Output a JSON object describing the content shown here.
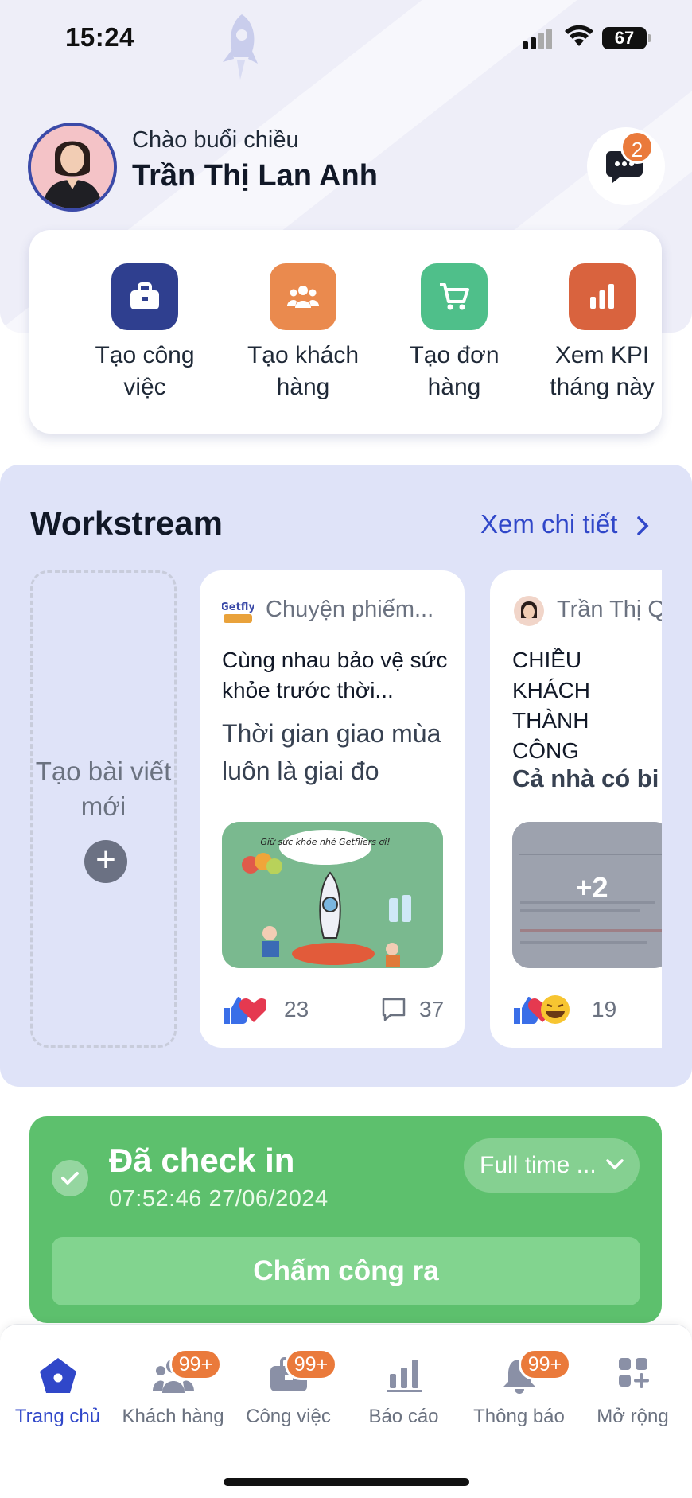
{
  "status_bar": {
    "time": "15:24",
    "battery": "67"
  },
  "greeting": {
    "subtitle": "Chào buổi chiều",
    "name": "Trần Thị Lan Anh",
    "chat_badge": "2"
  },
  "quick_actions": [
    {
      "label": "Tạo công việc",
      "icon": "briefcase-icon",
      "color": "#2f3f8f"
    },
    {
      "label": "Tạo khách hàng",
      "icon": "users-icon",
      "color": "#ea8a4e"
    },
    {
      "label": "Tạo đơn hàng",
      "icon": "cart-icon",
      "color": "#4fbf8a"
    },
    {
      "label": "Xem KPI tháng này",
      "icon": "bar-chart-icon",
      "color": "#d9633e"
    }
  ],
  "workstream": {
    "title": "Workstream",
    "link": "Xem chi tiết",
    "new_post_label": "Tạo bài viết mới",
    "posts": [
      {
        "author": "Chuyện phiếm...",
        "title": "Cùng nhau bảo vệ sức khỏe trước thời...",
        "body": "Thời gian giao mùa luôn là giai đo",
        "image_text": "Giữ sức khỏe nhé Getfliers ơi!",
        "likes": "23",
        "comments": "37"
      },
      {
        "author": "Trần Thị Q",
        "title": "CHIỀU KHÁCH THÀNH CÔNG",
        "body": "Cả nhà có bi",
        "image_more": "+2",
        "likes": "19"
      }
    ]
  },
  "checkin": {
    "title": "Đã check in",
    "time": "07:52:46 27/06/2024",
    "shift": "Full time ...",
    "button": "Chấm công ra"
  },
  "bottom_nav": [
    {
      "label": "Trang chủ",
      "icon": "home-icon",
      "active": true
    },
    {
      "label": "Khách hàng",
      "icon": "customers-icon",
      "badge": "99+"
    },
    {
      "label": "Công việc",
      "icon": "work-icon",
      "badge": "99+"
    },
    {
      "label": "Báo cáo",
      "icon": "report-icon"
    },
    {
      "label": "Thông báo",
      "icon": "bell-icon",
      "badge": "99+"
    },
    {
      "label": "Mở rộng",
      "icon": "grid-plus-icon"
    }
  ],
  "colors": {
    "accent": "#3047c9",
    "checkin_green": "#5dc06d",
    "badge_orange": "#ea7a3b",
    "workstream_bg": "#dfe3f8"
  }
}
